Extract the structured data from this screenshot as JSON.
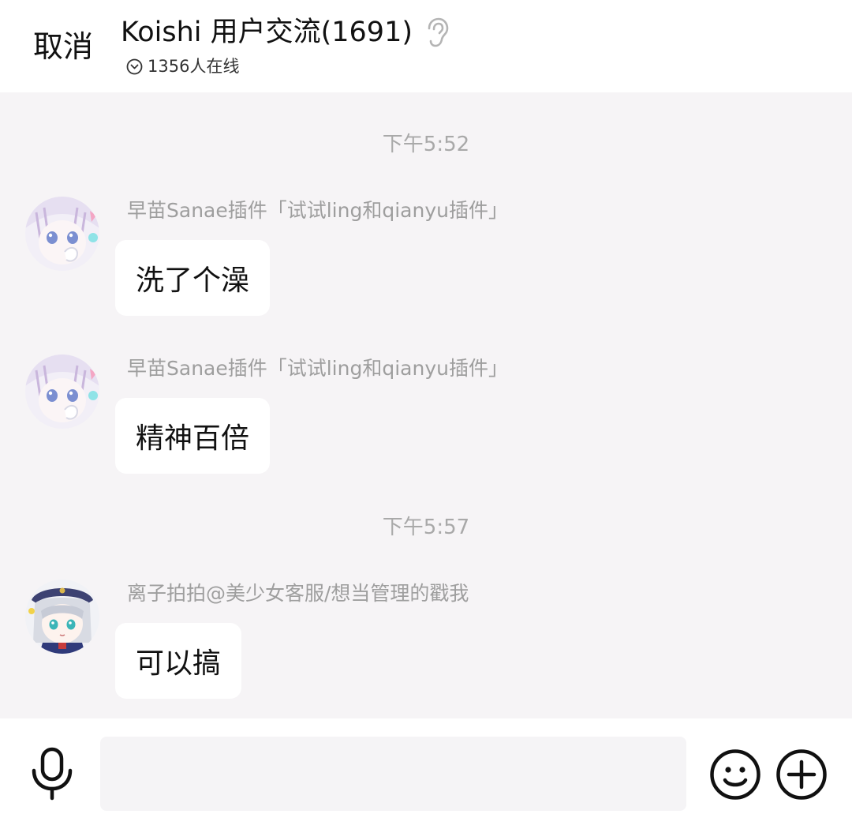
{
  "header": {
    "cancel_label": "取消",
    "title": "Koishi 用户交流(1691)",
    "online_text": "1356人在线",
    "ear_icon": "ear-icon",
    "online_icon": "chevron-circle-icon"
  },
  "messages": [
    {
      "timestamp": "下午5:52"
    },
    {
      "sender": "早苗Sanae插件「试试ling和qianyu插件」",
      "text": "洗了个澡"
    },
    {
      "sender": "早苗Sanae插件「试试ling和qianyu插件」",
      "text": "精神百倍"
    },
    {
      "timestamp": "下午5:57"
    },
    {
      "sender": "离子拍拍@美少女客服/想当管理的戳我",
      "text": "可以搞"
    }
  ],
  "input_bar": {
    "placeholder": "",
    "mic_icon": "microphone-icon",
    "emoji_icon": "smiley-icon",
    "plus_icon": "plus-circle-icon"
  },
  "colors": {
    "chat_background": "#f6f4f6",
    "bubble_background": "#ffffff",
    "timestamp_text": "#a9a9a9",
    "sender_text": "#9e9e9e"
  }
}
